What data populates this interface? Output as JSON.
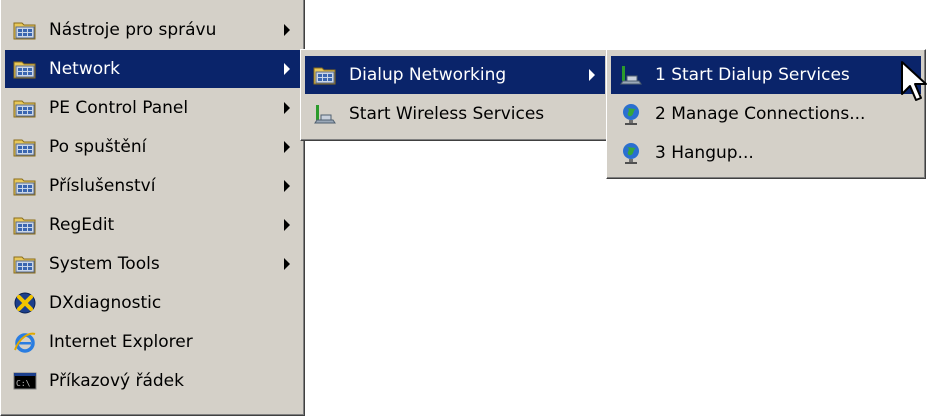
{
  "menu_main": {
    "items": [
      {
        "label": "Nástroje pro správu",
        "icon": "folder-icon",
        "submenu": true
      },
      {
        "label": "Network",
        "icon": "folder-icon",
        "submenu": true,
        "highlighted": true
      },
      {
        "label": "PE Control Panel",
        "icon": "folder-icon",
        "submenu": true
      },
      {
        "label": "Po spuštění",
        "icon": "folder-icon",
        "submenu": true
      },
      {
        "label": "Příslušenství",
        "icon": "folder-icon",
        "submenu": true
      },
      {
        "label": "RegEdit",
        "icon": "folder-icon",
        "submenu": true
      },
      {
        "label": "System Tools",
        "icon": "folder-icon",
        "submenu": true
      },
      {
        "label": "DXdiagnostic",
        "icon": "directx-icon",
        "submenu": false
      },
      {
        "label": "Internet Explorer",
        "icon": "internet-explorer-icon",
        "submenu": false
      },
      {
        "label": "Příkazový řádek",
        "icon": "command-prompt-icon",
        "submenu": false
      }
    ]
  },
  "menu_network": {
    "items": [
      {
        "label": "Dialup Networking",
        "icon": "folder-icon",
        "submenu": true,
        "highlighted": true
      },
      {
        "label": "Start Wireless Services",
        "icon": "network-service-icon",
        "submenu": false
      }
    ]
  },
  "menu_dialup": {
    "items": [
      {
        "label": "1 Start Dialup Services",
        "icon": "network-service-icon",
        "highlighted": true
      },
      {
        "label": "2 Manage Connections...",
        "icon": "globe-icon"
      },
      {
        "label": "3 Hangup...",
        "icon": "globe-icon"
      }
    ]
  },
  "colors": {
    "menu_bg": "#d4d0c8",
    "highlight": "#0a246a"
  }
}
